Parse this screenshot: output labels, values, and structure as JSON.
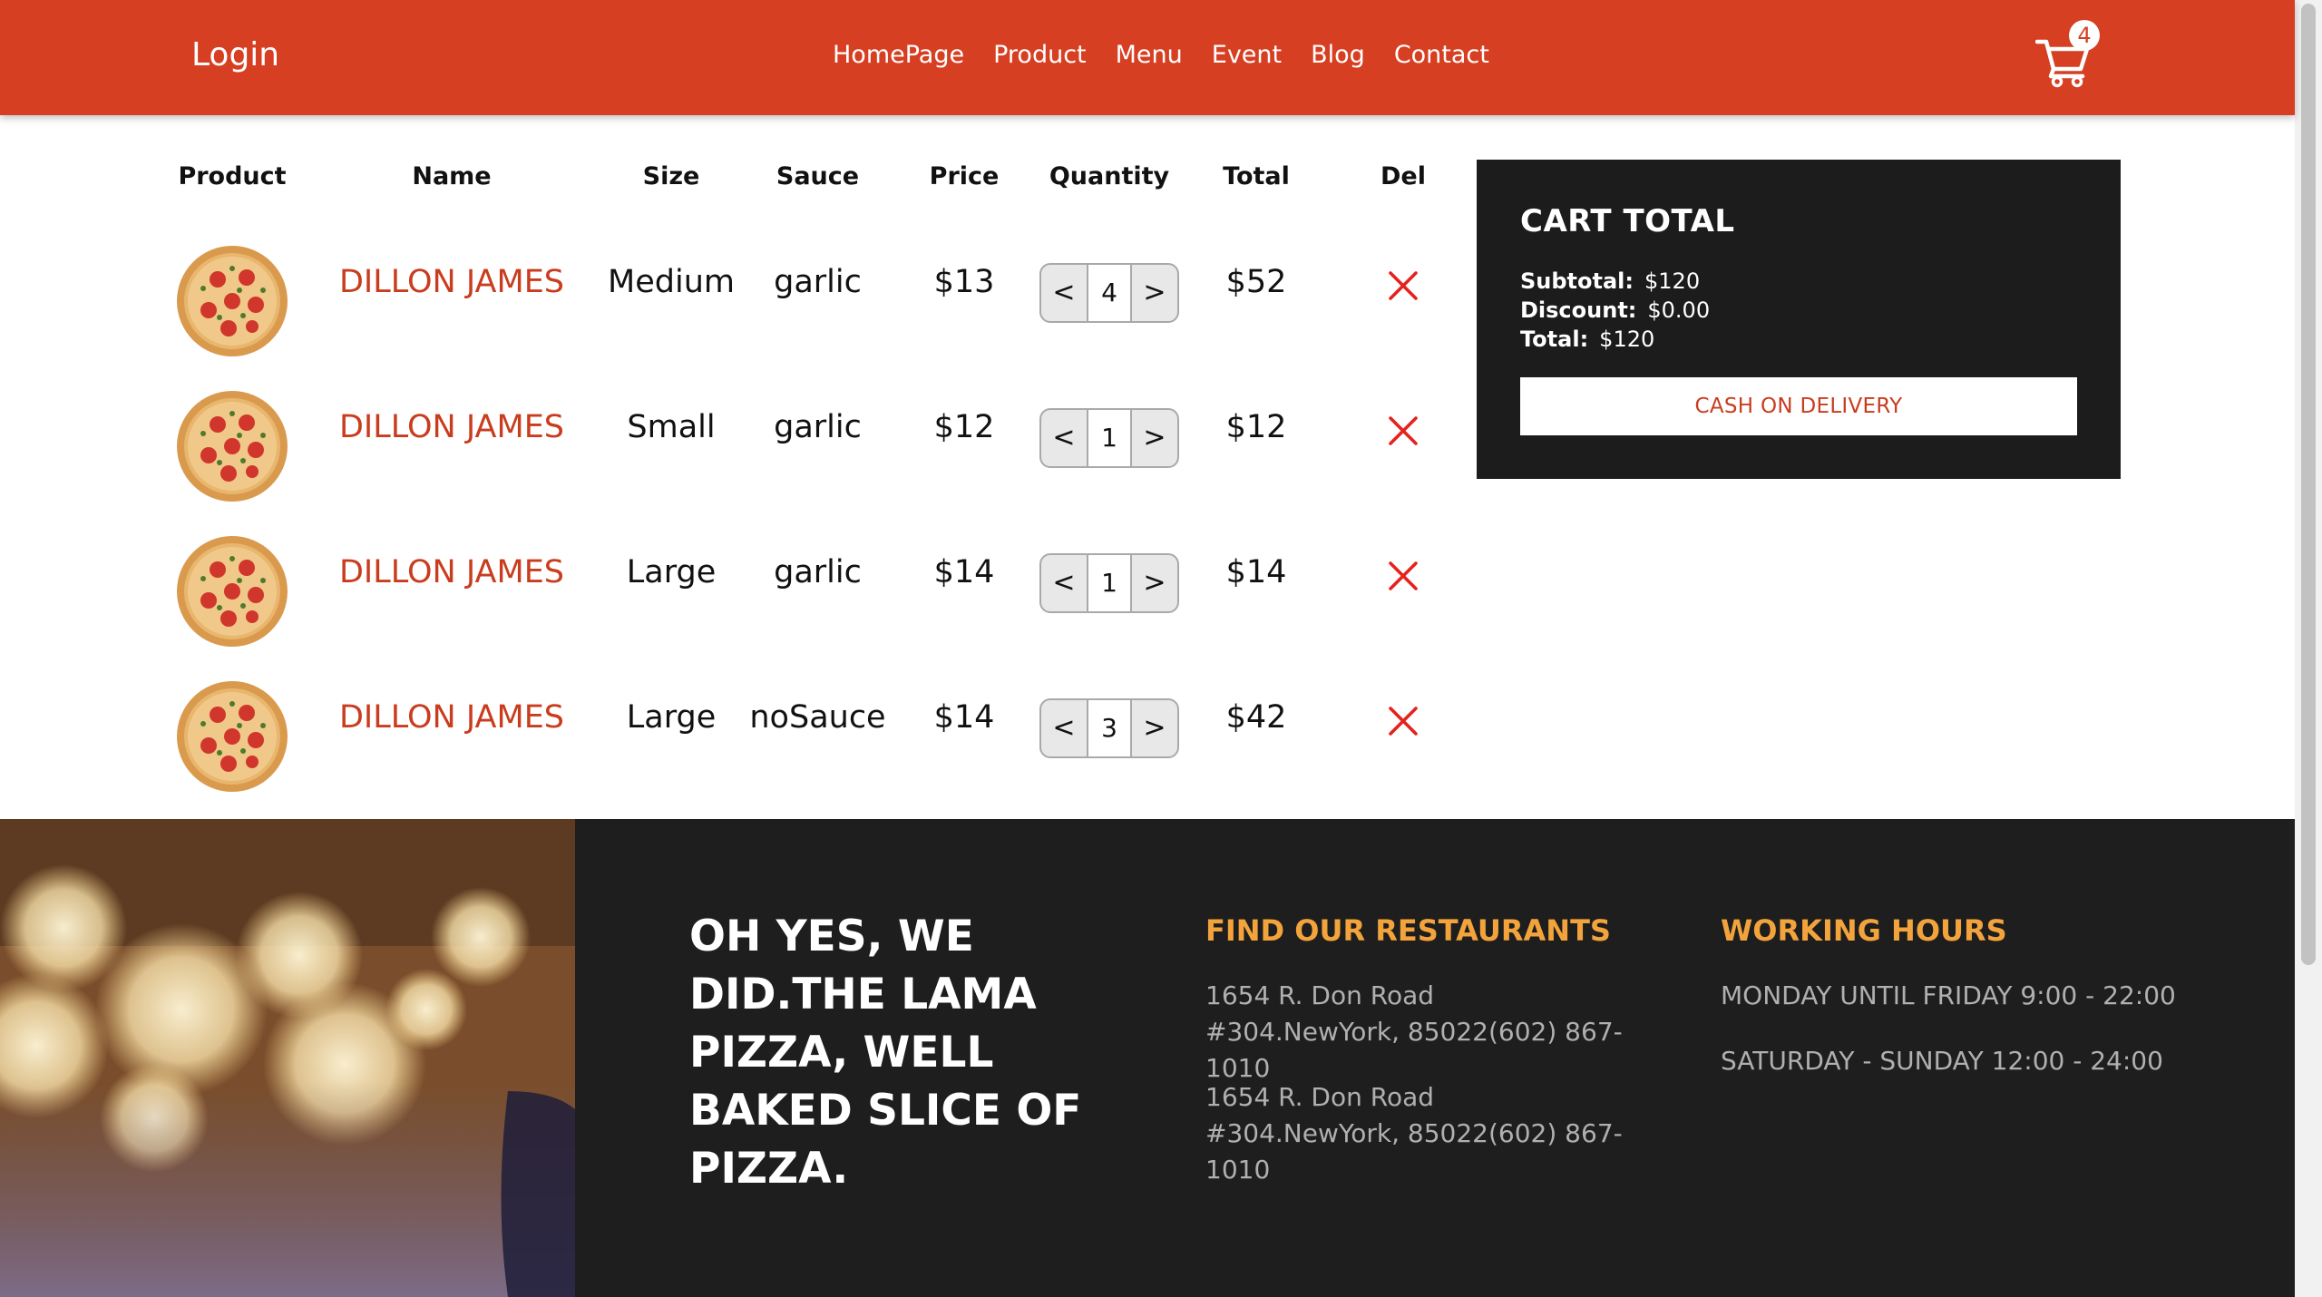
{
  "navbar": {
    "login": "Login",
    "links": [
      "HomePage",
      "Product",
      "Menu",
      "Event",
      "Blog",
      "Contact"
    ],
    "cart_count": "4",
    "cart_icon": "shopping-cart-icon"
  },
  "table": {
    "headers": {
      "product": "Product",
      "name": "Name",
      "size": "Size",
      "sauce": "Sauce",
      "price": "Price",
      "quantity": "Quantity",
      "total": "Total",
      "del": "Del"
    },
    "rows": [
      {
        "name": "DILLON JAMES",
        "size": "Medium",
        "sauce": "garlic",
        "price": "$13",
        "quantity": "4",
        "total": "$52"
      },
      {
        "name": "DILLON JAMES",
        "size": "Small",
        "sauce": "garlic",
        "price": "$12",
        "quantity": "1",
        "total": "$12"
      },
      {
        "name": "DILLON JAMES",
        "size": "Large",
        "sauce": "garlic",
        "price": "$14",
        "quantity": "1",
        "total": "$14"
      },
      {
        "name": "DILLON JAMES",
        "size": "Large",
        "sauce": "noSauce",
        "price": "$14",
        "quantity": "3",
        "total": "$42"
      }
    ],
    "decrement_label": "<",
    "increment_label": ">"
  },
  "cart_total": {
    "title": "CART TOTAL",
    "subtotal_label": "Subtotal:",
    "subtotal": "$120",
    "discount_label": "Discount:",
    "discount": "$0.00",
    "total_label": "Total:",
    "total": "$120",
    "button": "CASH ON DELIVERY"
  },
  "footer": {
    "slogan": "OH YES, WE DID.THE LAMA PIZZA, WELL BAKED SLICE OF PIZZA.",
    "restaurants_title": "FIND OUR RESTAURANTS",
    "restaurants": [
      "1654 R. Don Road #304.NewYork, 85022(602) 867-1010",
      "1654 R. Don Road #304.NewYork, 85022(602) 867-1010"
    ],
    "hours_title": "WORKING HOURS",
    "hours": [
      "MONDAY UNTIL FRIDAY 9:00 - 22:00",
      "SATURDAY - SUNDAY 12:00 - 24:00"
    ]
  },
  "colors": {
    "brand": "#d63f22",
    "accent_text": "#c93c1e",
    "footer_heading": "#f2a33c",
    "dark_panel": "#1c1c1c"
  }
}
